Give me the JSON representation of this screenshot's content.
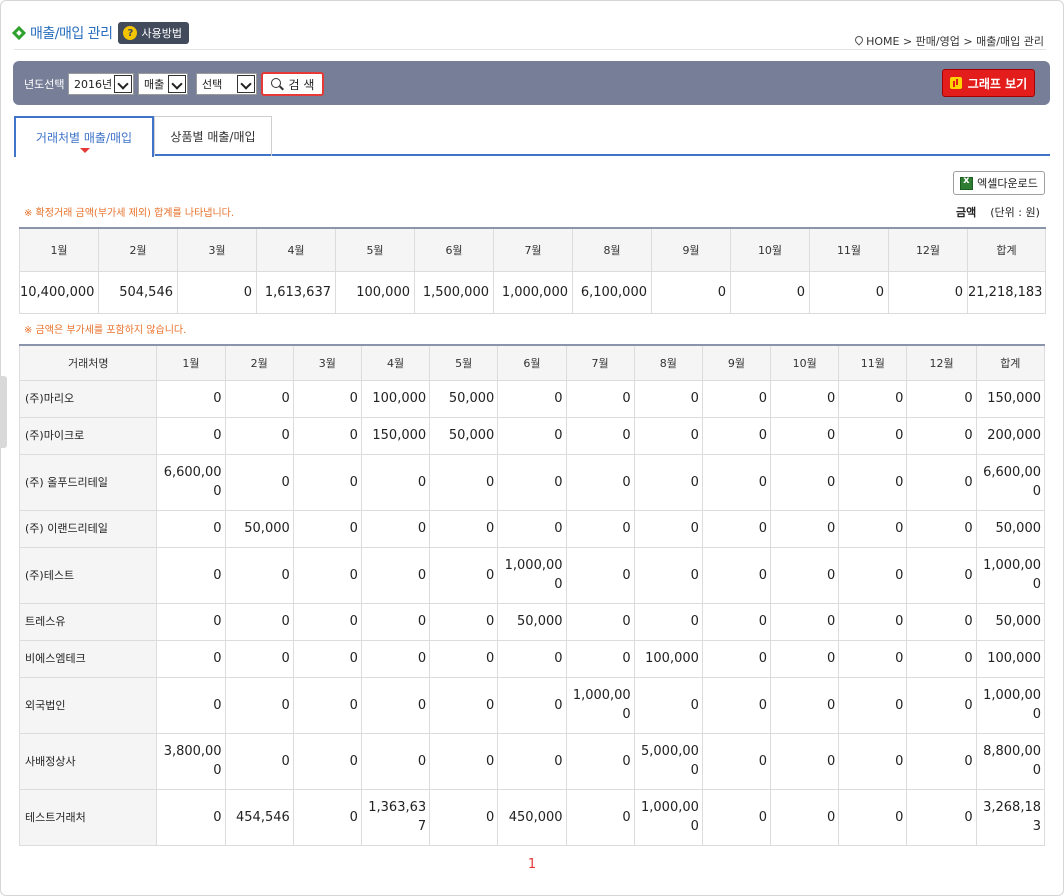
{
  "header": {
    "title": "매출/매입 관리",
    "help_label": "사용방법",
    "breadcrumb": "HOME > 판매/영업 > 매출/매입 관리"
  },
  "search": {
    "year_label": "년도선택 :",
    "year_value": "2016년",
    "type_value": "매출",
    "filter_value": "선택",
    "search_label": "검 색",
    "graph_label": "그래프 보기"
  },
  "tabs": [
    {
      "label": "거래처별 매출/매입"
    },
    {
      "label": "상품별 매출/매입"
    }
  ],
  "excel_label": "엑셀다운로드",
  "note1": "※ 확정거래 금액(부가세 제외) 합계를 나타냅니다.",
  "unit_title": "금액",
  "unit_text": "(단위 : 원)",
  "note2": "※ 금액은 부가세를 포함하지 않습니다.",
  "summary": {
    "headers": [
      "1월",
      "2월",
      "3월",
      "4월",
      "5월",
      "6월",
      "7월",
      "8월",
      "9월",
      "10월",
      "11월",
      "12월",
      "합계"
    ],
    "values": [
      "10,400,000",
      "504,546",
      "0",
      "1,613,637",
      "100,000",
      "1,500,000",
      "1,000,000",
      "6,100,000",
      "0",
      "0",
      "0",
      "0",
      "21,218,183"
    ]
  },
  "detail": {
    "headers": [
      "거래처명",
      "1월",
      "2월",
      "3월",
      "4월",
      "5월",
      "6월",
      "7월",
      "8월",
      "9월",
      "10월",
      "11월",
      "12월",
      "합계"
    ],
    "rows": [
      {
        "name": "(주)마리오",
        "cells": [
          "0",
          "0",
          "0",
          "100,000",
          "50,000",
          "0",
          "0",
          "0",
          "0",
          "0",
          "0",
          "0",
          "150,000"
        ]
      },
      {
        "name": "(주)마이크로",
        "cells": [
          "0",
          "0",
          "0",
          "150,000",
          "50,000",
          "0",
          "0",
          "0",
          "0",
          "0",
          "0",
          "0",
          "200,000"
        ]
      },
      {
        "name": " (주) 올푸드리테일",
        "cells": [
          "6,600,000",
          "0",
          "0",
          "0",
          "0",
          "0",
          "0",
          "0",
          "0",
          "0",
          "0",
          "0",
          "6,600,000"
        ]
      },
      {
        "name": " (주) 이랜드리테일",
        "cells": [
          "0",
          "50,000",
          "0",
          "0",
          "0",
          "0",
          "0",
          "0",
          "0",
          "0",
          "0",
          "0",
          "50,000"
        ]
      },
      {
        "name": "(주)테스트",
        "cells": [
          "0",
          "0",
          "0",
          "0",
          "0",
          "1,000,000",
          "0",
          "0",
          "0",
          "0",
          "0",
          "0",
          "1,000,000"
        ]
      },
      {
        "name": "트레스유",
        "cells": [
          "0",
          "0",
          "0",
          "0",
          "0",
          "50,000",
          "0",
          "0",
          "0",
          "0",
          "0",
          "0",
          "50,000"
        ]
      },
      {
        "name": "비에스엠테크",
        "cells": [
          "0",
          "0",
          "0",
          "0",
          "0",
          "0",
          "0",
          "100,000",
          "0",
          "0",
          "0",
          "0",
          "100,000"
        ]
      },
      {
        "name": "외국법인",
        "cells": [
          "0",
          "0",
          "0",
          "0",
          "0",
          "0",
          "1,000,000",
          "0",
          "0",
          "0",
          "0",
          "0",
          "1,000,000"
        ]
      },
      {
        "name": "사배정상사",
        "cells": [
          "3,800,000",
          "0",
          "0",
          "0",
          "0",
          "0",
          "0",
          "5,000,000",
          "0",
          "0",
          "0",
          "0",
          "8,800,000"
        ]
      },
      {
        "name": "테스트거래처",
        "cells": [
          "0",
          "454,546",
          "0",
          "1,363,637",
          "0",
          "450,000",
          "0",
          "1,000,000",
          "0",
          "0",
          "0",
          "0",
          "3,268,183"
        ]
      }
    ]
  },
  "pagination": {
    "current": "1"
  }
}
